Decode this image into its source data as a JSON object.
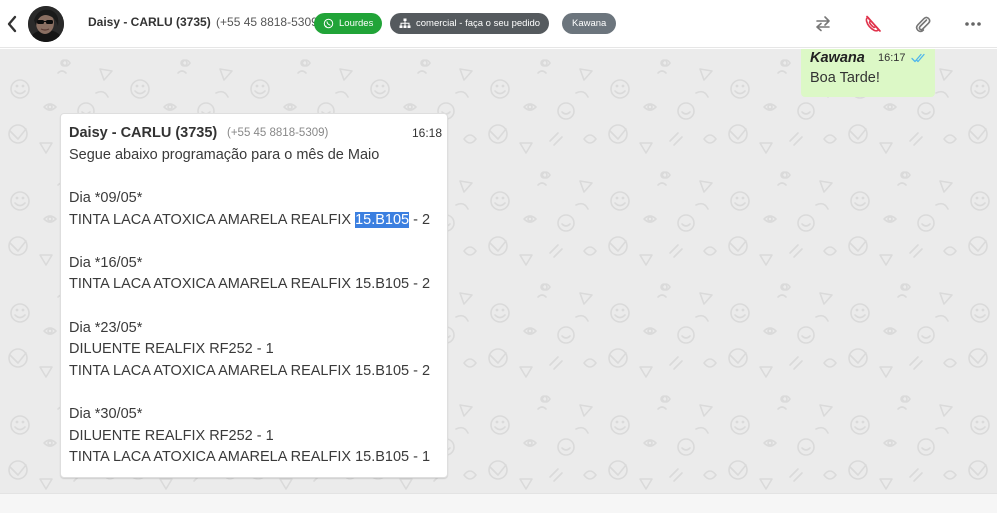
{
  "header": {
    "contact_name": "Daisy - CARLU (3735)",
    "contact_phone": "(+55 45 8818-5309)",
    "tags": [
      {
        "label": "Lourdes",
        "icon": "whatsapp-icon",
        "color": "#21a438"
      },
      {
        "label": "comercial - faça o seu pedido",
        "icon": "sitemap-icon",
        "color": "#555a5e"
      },
      {
        "label": "Kawana",
        "color": "#6c757d"
      }
    ],
    "actions": [
      "transfer-icon",
      "end-call-icon",
      "paperclip-icon",
      "more-icon"
    ],
    "end_call_color": "#e0334c"
  },
  "messages": {
    "outgoing": {
      "sender": "Kawana",
      "time": "16:17",
      "text": "Boa Tarde!",
      "status": "double-check-read-icon",
      "bubble_color": "#dcf8c6"
    },
    "incoming": {
      "sender": "Daisy - CARLU (3735)",
      "phone": "(+55 45 8818-5309)",
      "time": "16:18",
      "lines": [
        "Segue abaixo programação para o mês de Maio",
        "Dia *09/05*",
        "TINTA LACA ATOXICA AMARELA REALFIX",
        "15.B105",
        " - 2",
        "Dia *16/05*",
        "TINTA LACA ATOXICA AMARELA REALFIX 15.B105 - 2",
        "Dia *23/05*",
        "DILUENTE REALFIX RF252 - 1",
        "TINTA LACA ATOXICA AMARELA REALFIX 15.B105 - 2",
        "Dia *30/05*",
        "DILUENTE REALFIX RF252 - 1",
        "TINTA LACA ATOXICA AMARELA REALFIX 15.B105 - 1"
      ],
      "selection_color": "#3b7fe0"
    }
  }
}
